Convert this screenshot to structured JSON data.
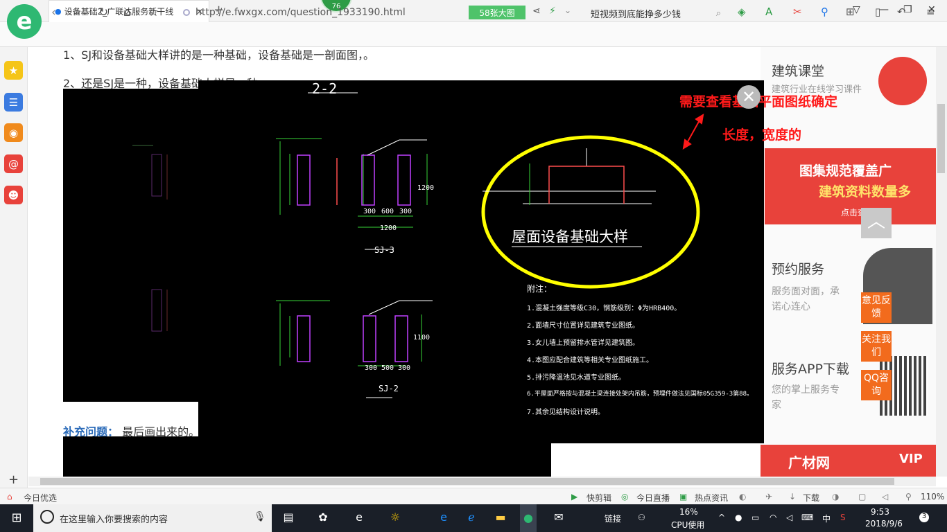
{
  "browser": {
    "tab_title": "设备基础2_广联达服务新干线",
    "tab_close": "✕",
    "new_tab": "+",
    "badge": "76",
    "url": "http://e.fwxgx.com/question_1933190.html",
    "big_image_btn": "58张大图",
    "search_text": "短视频到底能挣多少钱",
    "zoom": "110%"
  },
  "page": {
    "line1": "1、SJ和设备基础大样讲的是一种基础，设备基础是一剖面图，。",
    "line2": "2、还是SJ是一种，设备基础大样是一种",
    "supp_label": "补充问题：",
    "supp_text": "最后画出来的。"
  },
  "right_column": {
    "course_title": "建筑课堂",
    "course_sub": "建筑行业在线学习课件",
    "ad1_line1": "图集规范覆盖广",
    "ad1_line2": "建筑资料数量多",
    "ad1_cta": "点击查看",
    "service_title": "预约服务",
    "service_sub1": "服务面对面，承",
    "service_sub2": "诺心连心",
    "app_title": "服务APP下载",
    "app_sub1": "您的掌上服务专",
    "app_sub2": "家",
    "btn_feedback": "意见反馈",
    "btn_follow": "关注我们",
    "btn_qq": "QQ咨询",
    "ad2_text": "广材网",
    "ad2_vip": "VIP"
  },
  "viewer": {
    "annotation_line1": "需要查看基础平面图纸确定",
    "annotation_line2": "长度，宽度的",
    "sj3_label": "SJ-3",
    "sj2_label": "SJ-2",
    "roof_title": "屋面设备基础大样",
    "section_mark": "2-2",
    "dims_sj3": [
      "300",
      "600",
      "300",
      "1200",
      "1200"
    ],
    "dims_sj2": [
      "300",
      "500",
      "300",
      "1100"
    ],
    "notes_title": "附注：",
    "notes": [
      "1.混凝土强度等级C30，钢筋级别：Φ为HRB400。",
      "2.面墙尺寸位置详见建筑专业图纸。",
      "3.女儿墙上预留排水管详见建筑图。",
      "4.本图应配合建筑等相关专业图纸施工。",
      "5.排污降温池见水道专业图纸。",
      "6.平屋面严格按与混凝土梁连接处架内吊筋，预埋件做法见国标05G359-3第88。",
      "7.其余见结构设计说明。"
    ]
  },
  "statusbar": {
    "left": "今日优选",
    "items": [
      "快剪辑",
      "今日直播",
      "热点资讯",
      "下载"
    ],
    "zoom": "110%"
  },
  "taskbar": {
    "search_placeholder": "在这里输入你要搜索的内容",
    "links": "链接",
    "cpu": "16%",
    "cpu_label": "CPU使用",
    "ime": "中",
    "time": "9:53",
    "date": "2018/9/6",
    "notif": "3"
  },
  "colors": {
    "brand_green": "#2eb872",
    "accent_orange": "#f26b1d",
    "annotation_red": "#ff1a1a",
    "ellipse_yellow": "#ffff00"
  }
}
